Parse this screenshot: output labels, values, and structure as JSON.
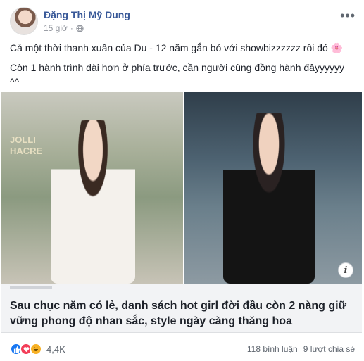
{
  "post": {
    "author": "Đặng Thị Mỹ Dung",
    "time": "15 giờ",
    "more_label": "•••",
    "text_lines": [
      "Cả một thời thanh xuân của Du - 12 năm gắn bó với showbizzzzzz rồi đó 🌸",
      "Còn 1 hành trình dài hơn ở phía trước, cần người cùng đồng hành đâyyyyyy ^^"
    ],
    "images": {
      "left_logo_text": "JOLLI\nHACRE"
    },
    "info_label": "i",
    "link": {
      "title": "Sau chục năm có lẻ, danh sách hot girl đời đầu còn 2 nàng giữ vững phong độ nhan sắc, style ngày càng thăng hoa"
    },
    "footer": {
      "reaction_count": "4,4K",
      "comments": "118 bình luận",
      "shares": "9 lượt chia sẻ"
    }
  }
}
